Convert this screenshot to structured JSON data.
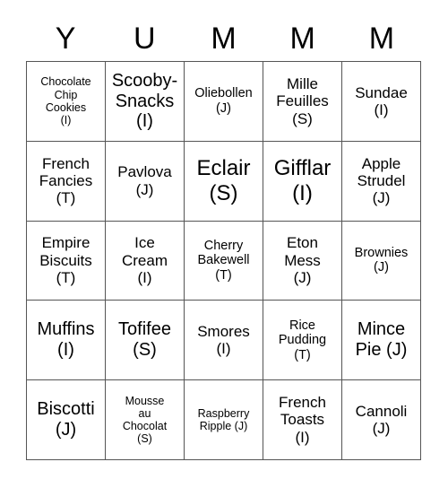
{
  "card": {
    "title_letters": [
      "Y",
      "U",
      "M",
      "M",
      "M"
    ],
    "columns": 5,
    "rows": 5,
    "border_color": "#555555",
    "text_color": "#000000",
    "background_color": "#ffffff",
    "cells": [
      {
        "text": "Chocolate\nChip\nCookies\n(I)",
        "label": "Chocolate Chip Cookies",
        "tag": "(I)",
        "size": "sz-xs"
      },
      {
        "text": "Scooby-\nSnacks\n(I)",
        "label": "Scooby-Snacks",
        "tag": "(I)",
        "size": "sz-l"
      },
      {
        "text": "Oliebollen\n(J)",
        "label": "Oliebollen",
        "tag": "(J)",
        "size": "sz-s"
      },
      {
        "text": "Mille\nFeuilles\n(S)",
        "label": "Mille Feuilles",
        "tag": "(S)",
        "size": "sz-m"
      },
      {
        "text": "Sundae\n(I)",
        "label": "Sundae",
        "tag": "(I)",
        "size": "sz-m"
      },
      {
        "text": "French\nFancies\n(T)",
        "label": "French Fancies",
        "tag": "(T)",
        "size": "sz-m"
      },
      {
        "text": "Pavlova\n(J)",
        "label": "Pavlova",
        "tag": "(J)",
        "size": "sz-m"
      },
      {
        "text": "Eclair\n(S)",
        "label": "Eclair",
        "tag": "(S)",
        "size": "sz-xl"
      },
      {
        "text": "Gifflar\n(I)",
        "label": "Gifflar",
        "tag": "(I)",
        "size": "sz-xl"
      },
      {
        "text": "Apple\nStrudel\n(J)",
        "label": "Apple Strudel",
        "tag": "(J)",
        "size": "sz-m"
      },
      {
        "text": "Empire\nBiscuits\n(T)",
        "label": "Empire Biscuits",
        "tag": "(T)",
        "size": "sz-m"
      },
      {
        "text": "Ice\nCream\n(I)",
        "label": "Ice Cream",
        "tag": "(I)",
        "size": "sz-m"
      },
      {
        "text": "Cherry\nBakewell\n(T)",
        "label": "Cherry Bakewell",
        "tag": "(T)",
        "size": "sz-s"
      },
      {
        "text": "Eton\nMess\n(J)",
        "label": "Eton Mess",
        "tag": "(J)",
        "size": "sz-m"
      },
      {
        "text": "Brownies\n(J)",
        "label": "Brownies",
        "tag": "(J)",
        "size": "sz-s"
      },
      {
        "text": "Muffins\n(I)",
        "label": "Muffins",
        "tag": "(I)",
        "size": "sz-l"
      },
      {
        "text": "Tofifee\n(S)",
        "label": "Tofifee",
        "tag": "(S)",
        "size": "sz-l"
      },
      {
        "text": "Smores\n(I)",
        "label": "Smores",
        "tag": "(I)",
        "size": "sz-m"
      },
      {
        "text": "Rice\nPudding\n(T)",
        "label": "Rice Pudding",
        "tag": "(T)",
        "size": "sz-s"
      },
      {
        "text": "Mince\nPie (J)",
        "label": "Mince Pie",
        "tag": "(J)",
        "size": "sz-l"
      },
      {
        "text": "Biscotti\n(J)",
        "label": "Biscotti",
        "tag": "(J)",
        "size": "sz-l"
      },
      {
        "text": "Mousse\nau\nChocolat\n(S)",
        "label": "Mousse au Chocolat",
        "tag": "(S)",
        "size": "sz-xs"
      },
      {
        "text": "Raspberry\nRipple (J)",
        "label": "Raspberry Ripple",
        "tag": "(J)",
        "size": "sz-xs"
      },
      {
        "text": "French\nToasts\n(I)",
        "label": "French Toasts",
        "tag": "(I)",
        "size": "sz-m"
      },
      {
        "text": "Cannoli\n(J)",
        "label": "Cannoli",
        "tag": "(J)",
        "size": "sz-m"
      }
    ]
  }
}
